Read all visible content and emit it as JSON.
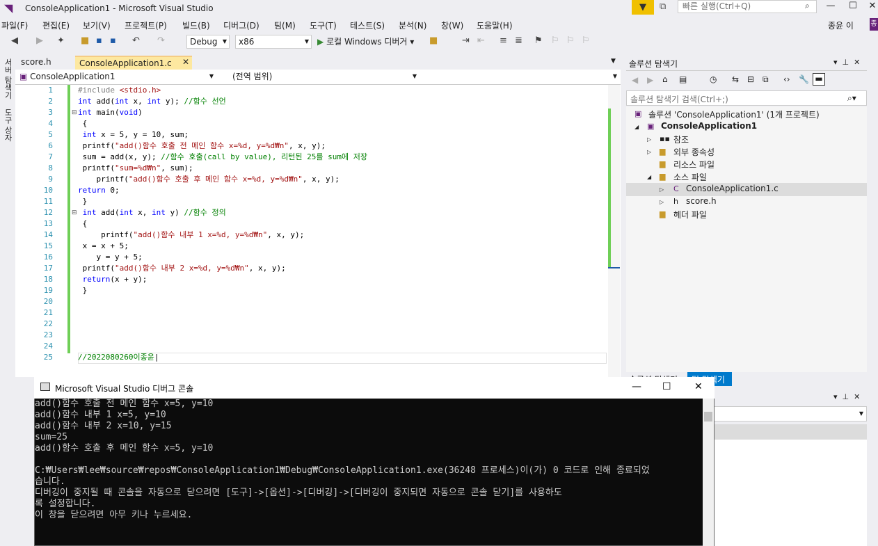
{
  "window": {
    "title": "ConsoleApplication1 - Microsoft Visual Studio",
    "quick_launch": "빠른 실행(Ctrl+Q)",
    "user": "종윤 이",
    "user_badge": "종"
  },
  "menu": [
    "파일(F)",
    "편집(E)",
    "보기(V)",
    "프로젝트(P)",
    "빌드(B)",
    "디버그(D)",
    "팀(M)",
    "도구(T)",
    "테스트(S)",
    "분석(N)",
    "창(W)",
    "도움말(H)"
  ],
  "toolbar": {
    "config": "Debug",
    "platform": "x86",
    "run_label": "로컬 Windows 디버거"
  },
  "tabs": [
    {
      "label": "score.h"
    },
    {
      "label": "ConsoleApplication1.c"
    }
  ],
  "nav": {
    "project": "ConsoleApplication1",
    "scope": "(전역 범위)"
  },
  "code": {
    "line_numbers": [
      "1",
      "2",
      "3",
      "4",
      "5",
      "6",
      "7",
      "8",
      "9",
      "10",
      "11",
      "12",
      "13",
      "14",
      "15",
      "16",
      "17",
      "18",
      "19",
      "20",
      "21",
      "22",
      "23",
      "24",
      "25"
    ]
  },
  "solution_explorer": {
    "title": "솔루션 탐색기",
    "search": "솔루션 탐색기 검색(Ctrl+;)",
    "items": [
      "솔루션 'ConsoleApplication1' (1개 프로젝트)",
      "ConsoleApplication1",
      "참조",
      "외부 종속성",
      "리소스 파일",
      "소스 파일",
      "ConsoleApplication1.c",
      "score.h",
      "헤더 파일"
    ],
    "tab_partial": "솔루션 탐색기",
    "tab_team": "팀 탐색기"
  },
  "console": {
    "title": "Microsoft Visual Studio 디버그 콘솔",
    "text": "add()함수 호출 전 메인 함수 x=5, y=10\nadd()함수 내부 1 x=5, y=10\nadd()함수 내부 2 x=10, y=15\nsum=25\nadd()함수 호출 후 메인 함수 x=5, y=10\n\nC:₩Users₩lee₩source₩repos₩ConsoleApplication1₩Debug₩ConsoleApplication1.exe(36248 프로세스)이(가) 0 코드로 인해 종료되었\n습니다.\n디버깅이 중지될 때 콘솔을 자동으로 닫으려면 [도구]->[옵션]->[디버깅]->[디버깅이 중지되면 자동으로 콘솔 닫기]를 사용하도\n록 설정합니다.\n이 창을 닫으려면 아무 키나 누르세요."
  },
  "left_rail": [
    "서버 탐색기",
    "도구 상자"
  ]
}
